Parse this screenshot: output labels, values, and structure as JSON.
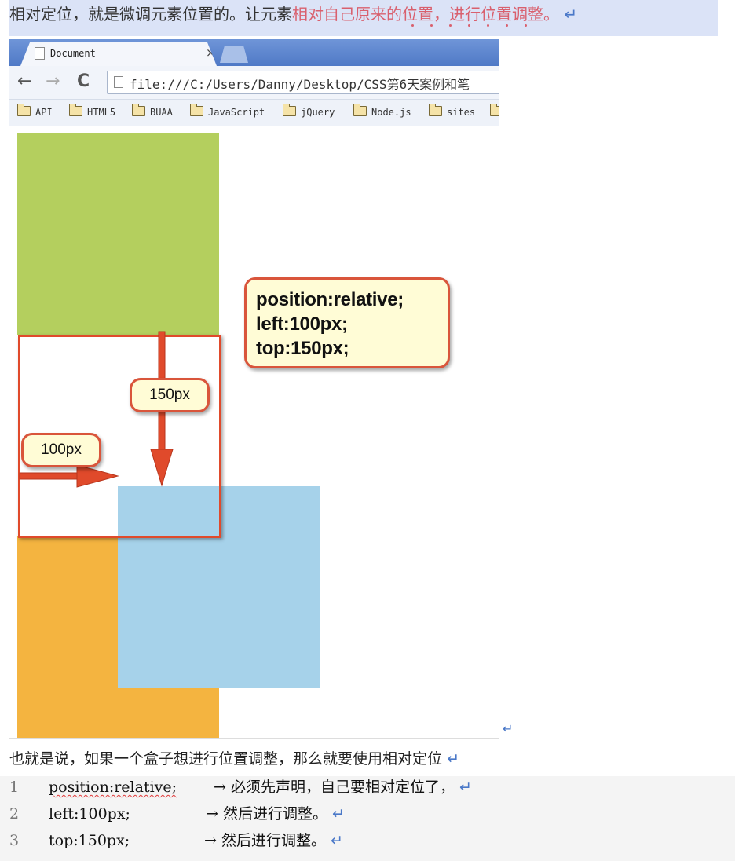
{
  "header": {
    "text_plain": "相对定位，就是微调元素位置的。让元素",
    "text_highlight": "相对自己原来的位置，进行位置调整。",
    "return_mark": "↵"
  },
  "browser": {
    "tab_title": "Document",
    "tab_close": "×",
    "back": "←",
    "forward": "→",
    "reload": "C",
    "url": "file:///C:/Users/Danny/Desktop/CSS第6天案例和笔",
    "bookmarks": [
      "API",
      "HTML5",
      "BUAA",
      "JavaScript",
      "jQuery",
      "Node.js",
      "sites"
    ]
  },
  "demo": {
    "callout_lines": [
      "position:relative;",
      "left:100px;",
      "top:150px;"
    ],
    "label_vertical": "150px",
    "label_horizontal": "100px",
    "colors": {
      "green": "#b4cf5e",
      "orange": "#f4b440",
      "blue": "#a6d2ea",
      "frame": "#e04a2b",
      "callout_bg": "#fffcd6"
    }
  },
  "summary": {
    "text": "也就是说，如果一个盒子想进行位置调整，那么就要使用相对定位"
  },
  "code": [
    {
      "num": "1",
      "code": "position:relative;",
      "comment": "→  必须先声明，自己要相对定位了，"
    },
    {
      "num": "2",
      "code": "left:100px;",
      "comment": "→  然后进行调整。"
    },
    {
      "num": "3",
      "code": "top:150px;",
      "comment": "→  然后进行调整。"
    }
  ]
}
